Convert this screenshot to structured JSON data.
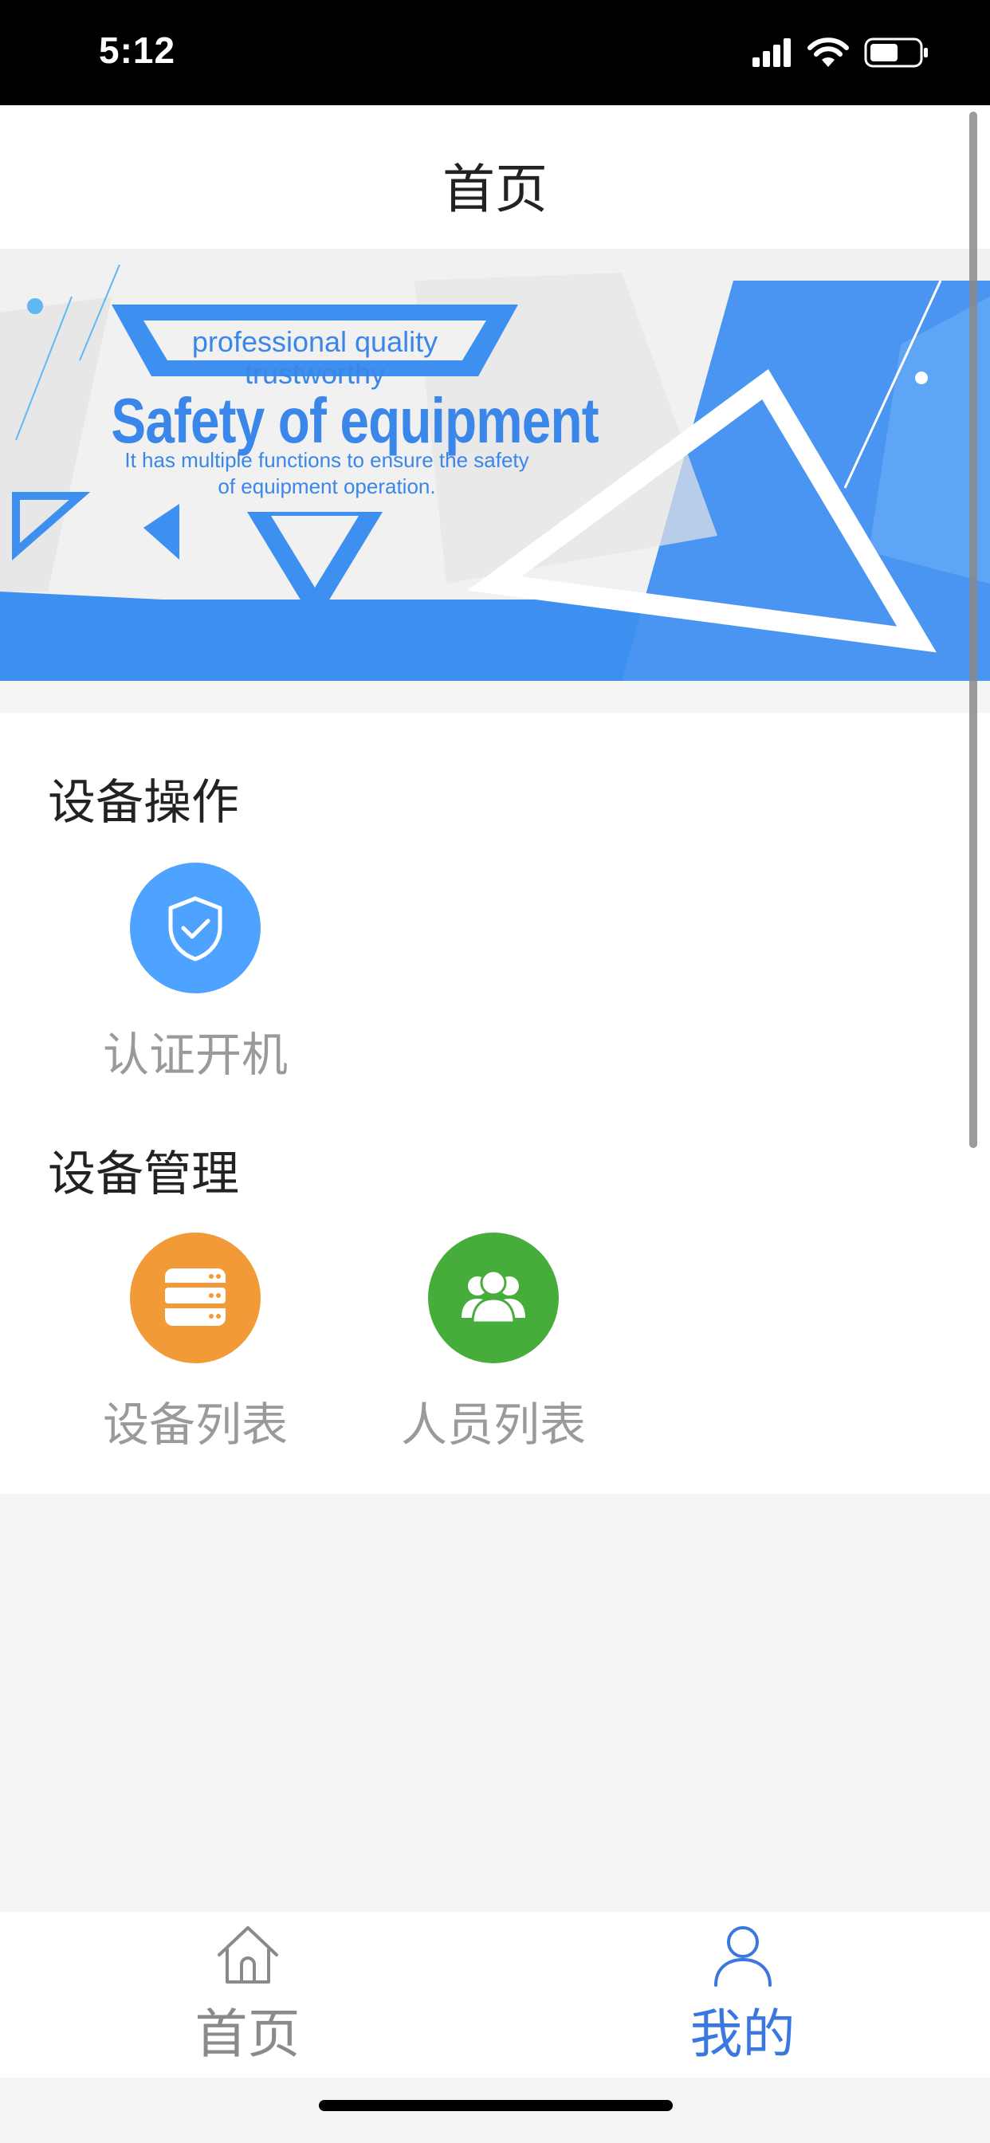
{
  "status_bar": {
    "time": "5:12"
  },
  "nav": {
    "title": "首页"
  },
  "banner": {
    "line1": "professional quality",
    "line2": "trustworthy",
    "headline": "Safety of equipment",
    "sub1": "It has multiple functions to ensure the safety",
    "sub2": "of equipment operation."
  },
  "sections": {
    "operation": {
      "title": "设备操作",
      "items": [
        {
          "label": "认证开机",
          "icon": "shield-check-icon",
          "color": "#4da3ff"
        }
      ]
    },
    "management": {
      "title": "设备管理",
      "items": [
        {
          "label": "设备列表",
          "icon": "server-icon",
          "color": "#f29a37"
        },
        {
          "label": "人员列表",
          "icon": "people-icon",
          "color": "#47ad3a"
        }
      ]
    }
  },
  "tab_bar": {
    "tabs": [
      {
        "label": "首页",
        "icon": "home-icon",
        "active": false,
        "color": "#8a8a8a"
      },
      {
        "label": "我的",
        "icon": "user-icon",
        "active": true,
        "color": "#3a78e0"
      }
    ]
  }
}
